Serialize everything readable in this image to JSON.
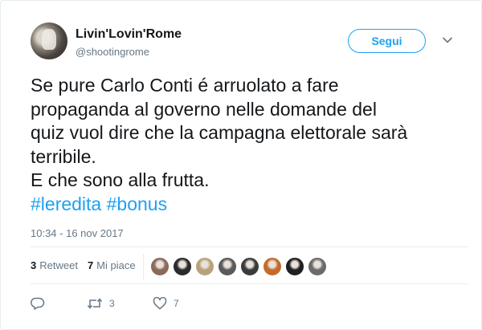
{
  "author": {
    "name": "Livin'Lovin'Rome",
    "handle": "@shootingrome"
  },
  "follow_label": "Segui",
  "tweet": {
    "lines": [
      "Se pure Carlo Conti é arruolato a fare",
      "propaganda al governo nelle domande del",
      "quiz vuol dire che la campagna elettorale sarà",
      "terribile.",
      "E che sono alla frutta."
    ],
    "hashtags": [
      "#leredita",
      "#bonus"
    ]
  },
  "timestamp": "10:34 - 16 nov 2017",
  "stats": {
    "retweets_count": "3",
    "retweets_label": "Retweet",
    "likes_count": "7",
    "likes_label": "Mi piace"
  },
  "liker_avatars": [
    {
      "icon": "user-avatar",
      "color": "#8a6a5a"
    },
    {
      "icon": "user-avatar",
      "color": "#2b2b2b"
    },
    {
      "icon": "user-avatar",
      "color": "#b9a27a"
    },
    {
      "icon": "user-avatar",
      "color": "#5a5a5a"
    },
    {
      "icon": "user-avatar",
      "color": "#3b3b3b"
    },
    {
      "icon": "user-avatar",
      "color": "#c46a2c"
    },
    {
      "icon": "user-avatar",
      "color": "#1f1f1f"
    },
    {
      "icon": "user-avatar",
      "color": "#6b6b6b"
    }
  ],
  "actions": {
    "reply_icon": "reply-icon",
    "retweet_icon": "retweet-icon",
    "retweet_count": "3",
    "like_icon": "heart-icon",
    "like_count": "7"
  },
  "colors": {
    "accent": "#1da1f2",
    "text": "#14171a",
    "muted": "#657786",
    "border": "#e6ecf0"
  }
}
